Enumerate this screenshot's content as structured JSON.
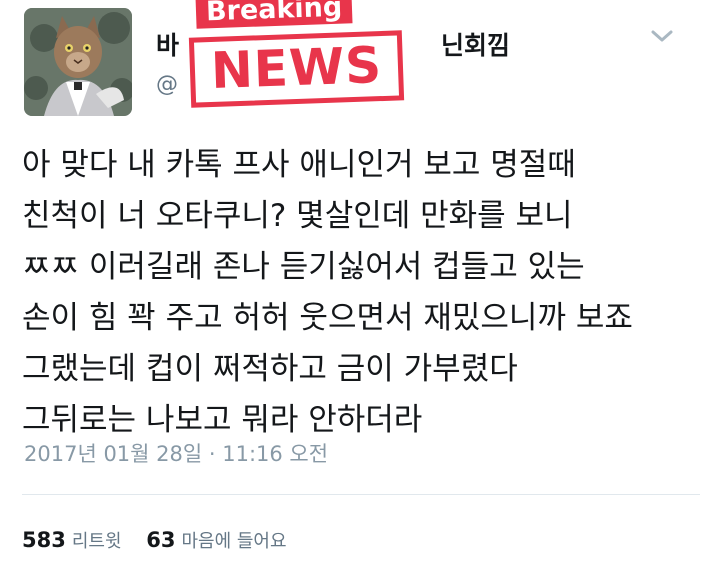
{
  "author": {
    "name": "바",
    "name_tail": "닌회낌",
    "handle": "@"
  },
  "sticker": {
    "breaking": "Breaking",
    "news": "NEWS"
  },
  "tweet": {
    "lines": [
      "아 맞다 내 카톡 프사 애니인거 보고 명절때",
      "친척이 너 오타쿠니? 몇살인데 만화를 보니",
      "ㅉㅉ 이러길래 존나 듣기싫어서 컵들고 있는",
      "손이 힘 꽉 주고 허허 웃으면서 재밌으니까 보죠",
      "그랬는데 컵이 쩌적하고 금이 가부렸다",
      "그뒤로는 나보고 뭐라 안하더라"
    ],
    "timestamp": "2017년 01월 28일 · 11:16 오전"
  },
  "stats": {
    "retweets_count": "583",
    "retweets_label": "리트윗",
    "likes_count": "63",
    "likes_label": "마음에 들어요"
  },
  "icons": {
    "caret": "chevron-down-icon",
    "avatar": "cat-avatar-image"
  }
}
